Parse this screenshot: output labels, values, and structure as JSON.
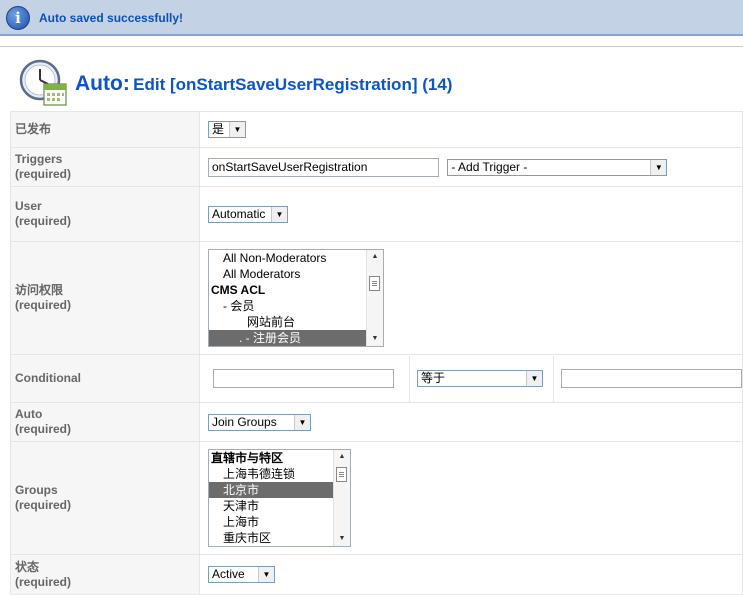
{
  "message": {
    "text": "Auto saved successfully!",
    "icon": "info-icon"
  },
  "header": {
    "title_big": "Auto:",
    "title_rest": "Edit [onStartSaveUserRegistration] (14)",
    "icon": "clock-calendar-icon"
  },
  "rows": {
    "published": {
      "label": "已发布",
      "value": "是"
    },
    "triggers": {
      "label": "Triggers",
      "required": "(required)",
      "value": "onStartSaveUserRegistration",
      "add": "- Add Trigger -"
    },
    "user": {
      "label": "User",
      "required": "(required)",
      "value": "Automatic"
    },
    "access": {
      "label": "访问权限",
      "required": "(required)",
      "items": [
        "All Non-Moderators",
        "All Moderators",
        "CMS ACL",
        "- 会员",
        "网站前台",
        ". - 注册会员"
      ]
    },
    "conditional": {
      "label": "Conditional",
      "field": "",
      "operator": "等于",
      "value": ""
    },
    "auto": {
      "label": "Auto",
      "required": "(required)",
      "value": "Join Groups"
    },
    "groups": {
      "label": "Groups",
      "required": "(required)",
      "items": [
        "直辖市与特区",
        "上海韦德连锁",
        "北京市",
        "天津市",
        "上海市",
        "重庆市区"
      ]
    },
    "status": {
      "label": "状态",
      "required": "(required)",
      "value": "Active"
    }
  }
}
